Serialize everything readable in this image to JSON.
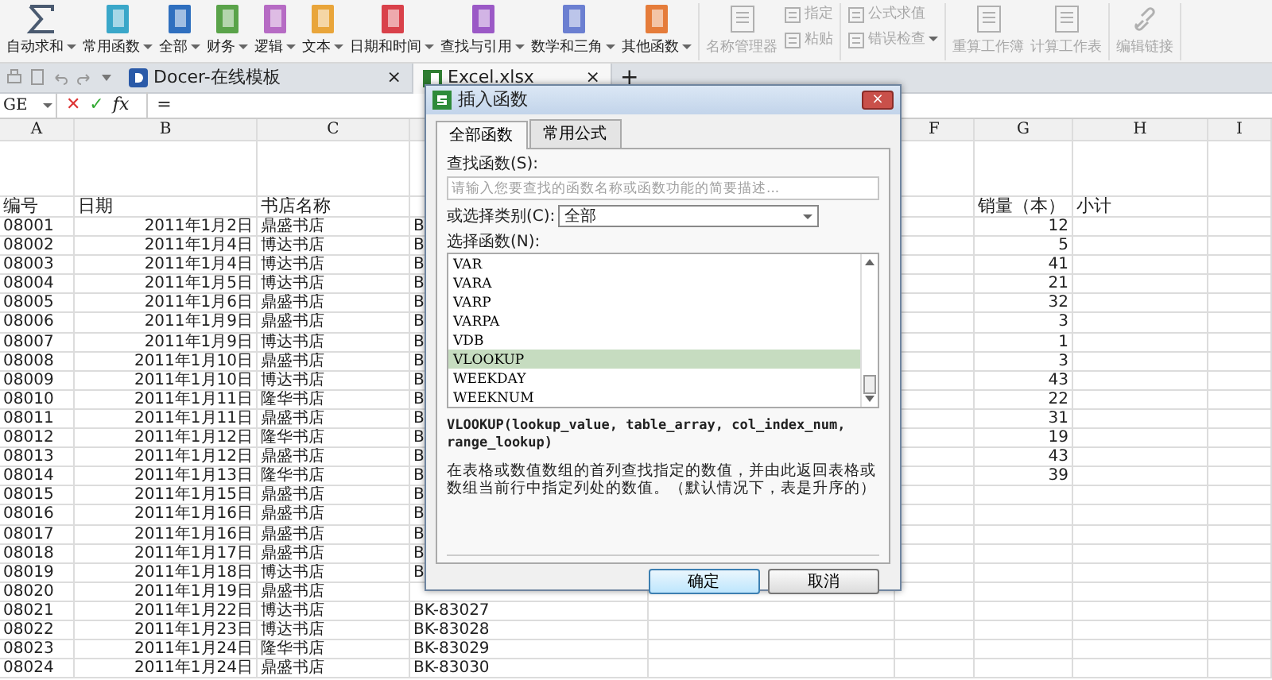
{
  "ribbon": {
    "groups": [
      {
        "columns": [
          {
            "items": [
              {
                "label": "自动求和",
                "kind": "sigma",
                "dropdown": true,
                "disabled": false
              }
            ]
          },
          {
            "items": [
              {
                "label": "常用函数",
                "kind": "book",
                "color": "#3aa7c9",
                "dropdown": true,
                "disabled": false
              }
            ]
          },
          {
            "items": [
              {
                "label": "全部",
                "kind": "book",
                "color": "#2f6fbf",
                "dropdown": true,
                "disabled": false
              }
            ]
          },
          {
            "items": [
              {
                "label": "财务",
                "kind": "book",
                "color": "#5aa34a",
                "dropdown": true,
                "disabled": false
              }
            ]
          },
          {
            "items": [
              {
                "label": "逻辑",
                "kind": "book",
                "color": "#b66bc4",
                "dropdown": true,
                "disabled": false
              }
            ]
          },
          {
            "items": [
              {
                "label": "文本",
                "kind": "book",
                "color": "#e9a53a",
                "dropdown": true,
                "disabled": false
              }
            ]
          },
          {
            "items": [
              {
                "label": "日期和时间",
                "kind": "book",
                "color": "#d9414a",
                "dropdown": true,
                "disabled": false
              }
            ]
          },
          {
            "items": [
              {
                "label": "查找与引用",
                "kind": "book",
                "color": "#9b59c6",
                "dropdown": true,
                "disabled": false
              }
            ]
          },
          {
            "items": [
              {
                "label": "数学和三角",
                "kind": "book",
                "color": "#6b7fd1",
                "dropdown": true,
                "disabled": false
              }
            ]
          },
          {
            "items": [
              {
                "label": "其他函数",
                "kind": "book",
                "color": "#e57c3a",
                "dropdown": true,
                "disabled": false
              }
            ]
          }
        ]
      },
      {
        "columns": [
          {
            "items": [
              {
                "label": "名称管理器",
                "kind": "tool",
                "dropdown": false,
                "disabled": true
              }
            ]
          },
          {
            "items": [
              {
                "label": "指定",
                "kind": "tool",
                "dropdown": false,
                "disabled": true
              },
              {
                "label": "粘贴",
                "kind": "tool",
                "dropdown": false,
                "disabled": true
              }
            ]
          }
        ]
      },
      {
        "columns": [
          {
            "items": [
              {
                "label": "公式求值",
                "kind": "tool",
                "dropdown": false,
                "disabled": true
              },
              {
                "label": "错误检查",
                "kind": "tool",
                "dropdown": true,
                "disabled": true
              }
            ]
          }
        ]
      },
      {
        "columns": [
          {
            "items": [
              {
                "label": "重算工作簿",
                "kind": "tool",
                "dropdown": false,
                "disabled": true
              }
            ]
          },
          {
            "items": [
              {
                "label": "计算工作表",
                "kind": "tool",
                "dropdown": false,
                "disabled": true
              }
            ]
          }
        ]
      },
      {
        "columns": [
          {
            "items": [
              {
                "label": "编辑链接",
                "kind": "link",
                "dropdown": false,
                "disabled": true
              }
            ]
          }
        ]
      }
    ]
  },
  "doc_tabs": [
    {
      "label": "Docer-在线模板",
      "kind": "docer",
      "selected": false,
      "close": "×"
    },
    {
      "label": "Excel.xlsx",
      "kind": "excel",
      "selected": true,
      "close": "×"
    }
  ],
  "new_tab": "+",
  "formula_bar": {
    "name_box": "GE",
    "cancel": "✕",
    "confirm": "✓",
    "fx": "fx",
    "value": "="
  },
  "columns": [
    "A",
    "B",
    "C",
    "F",
    "G",
    "H",
    "I"
  ],
  "sheet_header": {
    "a": "编号",
    "b": "日期",
    "c": "书店名称",
    "g": "销量（本）",
    "h": "小计"
  },
  "rows": [
    {
      "a": "08001",
      "b": "2011年1月2日",
      "c": "鼎盛书店",
      "d": "B",
      "g": "12"
    },
    {
      "a": "08002",
      "b": "2011年1月4日",
      "c": "博达书店",
      "d": "B",
      "g": "5"
    },
    {
      "a": "08003",
      "b": "2011年1月4日",
      "c": "博达书店",
      "d": "B",
      "g": "41"
    },
    {
      "a": "08004",
      "b": "2011年1月5日",
      "c": "博达书店",
      "d": "B",
      "g": "21"
    },
    {
      "a": "08005",
      "b": "2011年1月6日",
      "c": "鼎盛书店",
      "d": "B",
      "g": "32"
    },
    {
      "a": "08006",
      "b": "2011年1月9日",
      "c": "鼎盛书店",
      "d": "B",
      "g": "3"
    },
    {
      "a": "08007",
      "b": "2011年1月9日",
      "c": "博达书店",
      "d": "B",
      "g": "1"
    },
    {
      "a": "08008",
      "b": "2011年1月10日",
      "c": "鼎盛书店",
      "d": "B",
      "g": "3"
    },
    {
      "a": "08009",
      "b": "2011年1月10日",
      "c": "博达书店",
      "d": "B",
      "g": "43"
    },
    {
      "a": "08010",
      "b": "2011年1月11日",
      "c": "隆华书店",
      "d": "B",
      "g": "22"
    },
    {
      "a": "08011",
      "b": "2011年1月11日",
      "c": "鼎盛书店",
      "d": "B",
      "g": "31"
    },
    {
      "a": "08012",
      "b": "2011年1月12日",
      "c": "隆华书店",
      "d": "B",
      "g": "19"
    },
    {
      "a": "08013",
      "b": "2011年1月12日",
      "c": "鼎盛书店",
      "d": "B",
      "g": "43"
    },
    {
      "a": "08014",
      "b": "2011年1月13日",
      "c": "隆华书店",
      "d": "B",
      "g": "39"
    },
    {
      "a": "08015",
      "b": "2011年1月15日",
      "c": "鼎盛书店",
      "d": "B"
    },
    {
      "a": "08016",
      "b": "2011年1月16日",
      "c": "鼎盛书店",
      "d": "B"
    },
    {
      "a": "08017",
      "b": "2011年1月16日",
      "c": "鼎盛书店",
      "d": "B"
    },
    {
      "a": "08018",
      "b": "2011年1月17日",
      "c": "鼎盛书店",
      "d": "B"
    },
    {
      "a": "08019",
      "b": "2011年1月18日",
      "c": "博达书店",
      "d": "B"
    },
    {
      "a": "08020",
      "b": "2011年1月19日",
      "c": "鼎盛书店"
    },
    {
      "a": "08021",
      "b": "2011年1月22日",
      "c": "博达书店",
      "d": "BK-83027"
    },
    {
      "a": "08022",
      "b": "2011年1月23日",
      "c": "博达书店",
      "d": "BK-83028"
    },
    {
      "a": "08023",
      "b": "2011年1月24日",
      "c": "隆华书店",
      "d": "BK-83029"
    },
    {
      "a": "08024",
      "b": "2011年1月24日",
      "c": "鼎盛书店",
      "d": "BK-83030"
    }
  ],
  "dialog": {
    "title": "插入函数",
    "close": "×",
    "tabs": [
      {
        "label": "全部函数",
        "selected": true
      },
      {
        "label": "常用公式",
        "selected": false
      }
    ],
    "search_label": "查找函数(S):",
    "search_placeholder": "请输入您要查找的函数名称或函数功能的简要描述...",
    "category_label": "或选择类别(C):",
    "category_value": "全部",
    "list_label": "选择函数(N):",
    "functions": [
      {
        "name": "VAR",
        "selected": false
      },
      {
        "name": "VARA",
        "selected": false
      },
      {
        "name": "VARP",
        "selected": false
      },
      {
        "name": "VARPA",
        "selected": false
      },
      {
        "name": "VDB",
        "selected": false
      },
      {
        "name": "VLOOKUP",
        "selected": true
      },
      {
        "name": "WEEKDAY",
        "selected": false
      },
      {
        "name": "WEEKNUM",
        "selected": false
      }
    ],
    "syntax": "VLOOKUP(lookup_value, table_array, col_index_num, range_lookup)",
    "description": "在表格或数值数组的首列查找指定的数值，并由此返回表格或数组当前行中指定列处的数值。（默认情况下，表是升序的）",
    "buttons": [
      {
        "label": "确定",
        "kind": "primary"
      },
      {
        "label": "取消",
        "kind": "secondary"
      }
    ]
  }
}
